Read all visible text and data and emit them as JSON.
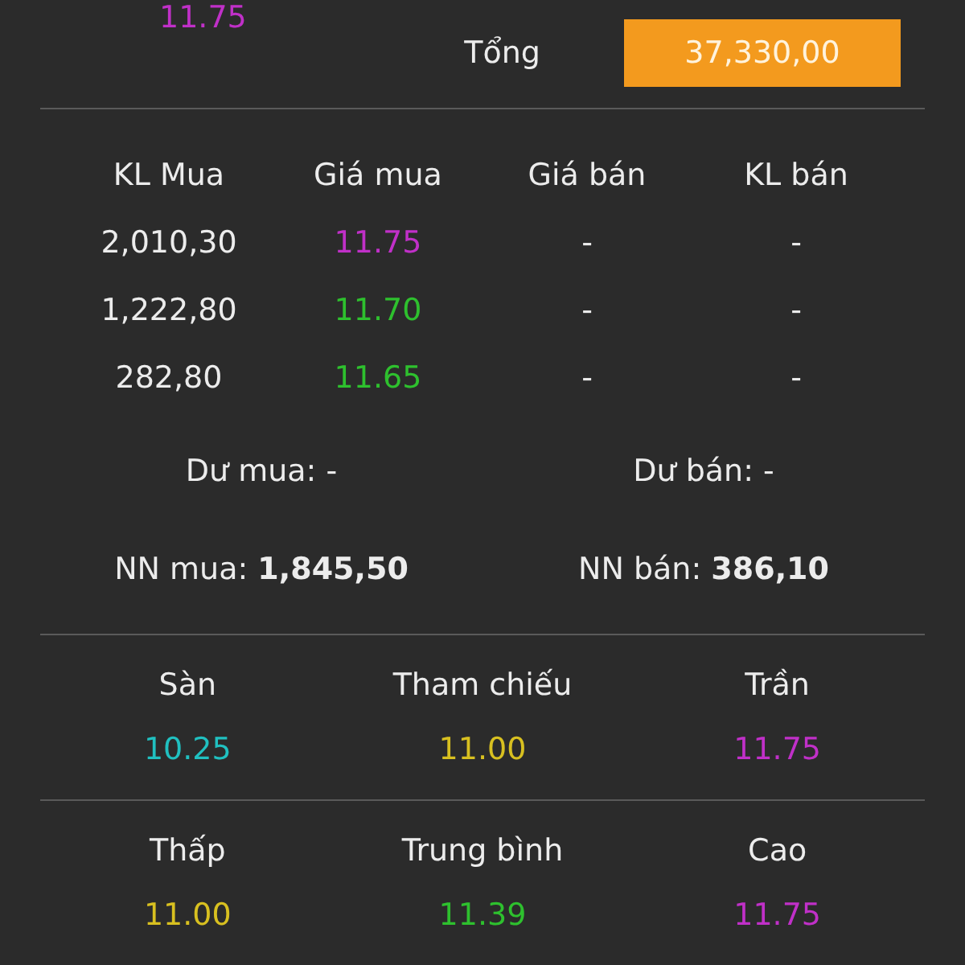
{
  "top_price": {
    "value": "11.75",
    "color": "#c030c8"
  },
  "total": {
    "label": "Tổng",
    "value": "37,330,00"
  },
  "order_book": {
    "columns": [
      "KL Mua",
      "Giá mua",
      "Giá bán",
      "KL bán"
    ],
    "rows": [
      {
        "buy_volume": "2,010,30",
        "buy_price": {
          "value": "11.75",
          "color": "#c030c8"
        },
        "sell_price": "-",
        "sell_volume": "-"
      },
      {
        "buy_volume": "1,222,80",
        "buy_price": {
          "value": "11.70",
          "color": "#2ec02e"
        },
        "sell_price": "-",
        "sell_volume": "-"
      },
      {
        "buy_volume": "282,80",
        "buy_price": {
          "value": "11.65",
          "color": "#2ec02e"
        },
        "sell_price": "-",
        "sell_volume": "-"
      }
    ]
  },
  "surplus": [
    {
      "label": "Dư mua: -"
    },
    {
      "label": "Dư bán: -"
    }
  ],
  "foreign": [
    {
      "label": "NN mua:",
      "value": "1,845,50"
    },
    {
      "label": "NN bán:",
      "value": "386,10"
    }
  ],
  "stat_groups": [
    [
      {
        "label": "Sàn",
        "value": "10.25",
        "color": "#20c0c0"
      },
      {
        "label": "Tham chiếu",
        "value": "11.00",
        "color": "#d8c020"
      },
      {
        "label": "Trần",
        "value": "11.75",
        "color": "#c030c8"
      }
    ],
    [
      {
        "label": "Thấp",
        "value": "11.00",
        "color": "#d8c020"
      },
      {
        "label": "Trung bình",
        "value": "11.39",
        "color": "#2ec02e"
      },
      {
        "label": "Cao",
        "value": "11.75",
        "color": "#c030c8"
      }
    ]
  ]
}
